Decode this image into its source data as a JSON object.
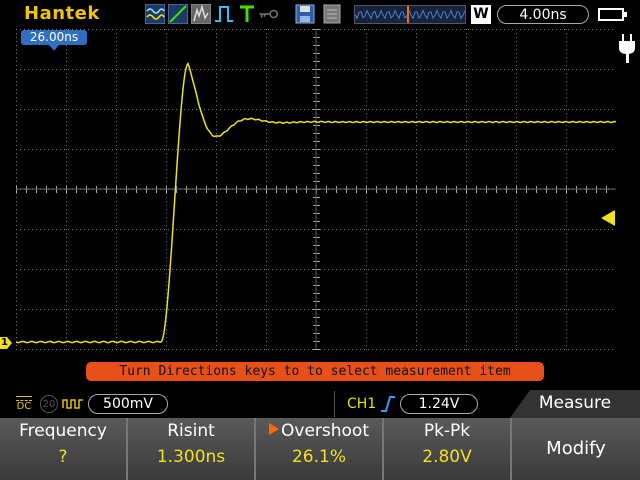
{
  "topbar": {
    "brand": "Hantek",
    "mode_indicator": "W",
    "timebase": "4.00ns"
  },
  "display": {
    "trigger_position": "26.00ns",
    "channel_marker": "1",
    "message": "Turn Directions keys to to select measurement item"
  },
  "status": {
    "coupling": "DC",
    "bandwidth_limit": "20",
    "volts_per_div": "500mV",
    "trigger_channel": "CH1",
    "trigger_level": "1.24V",
    "menu_title": "Measure"
  },
  "measurements": [
    {
      "label": "Frequency",
      "value": "?"
    },
    {
      "label": "Risint",
      "value": "1.300ns"
    },
    {
      "label": "Overshoot",
      "value": "26.1%"
    },
    {
      "label": "Pk-Pk",
      "value": "2.80V"
    }
  ],
  "selected_measurement_index": 2,
  "menu_button": "Modify",
  "colors": {
    "brand": "#f0c400",
    "trace": "#f0e020",
    "message_bg": "#e8501a",
    "trigger_tag": "#2e6fc0",
    "selection_arrow": "#ff6a00"
  }
}
